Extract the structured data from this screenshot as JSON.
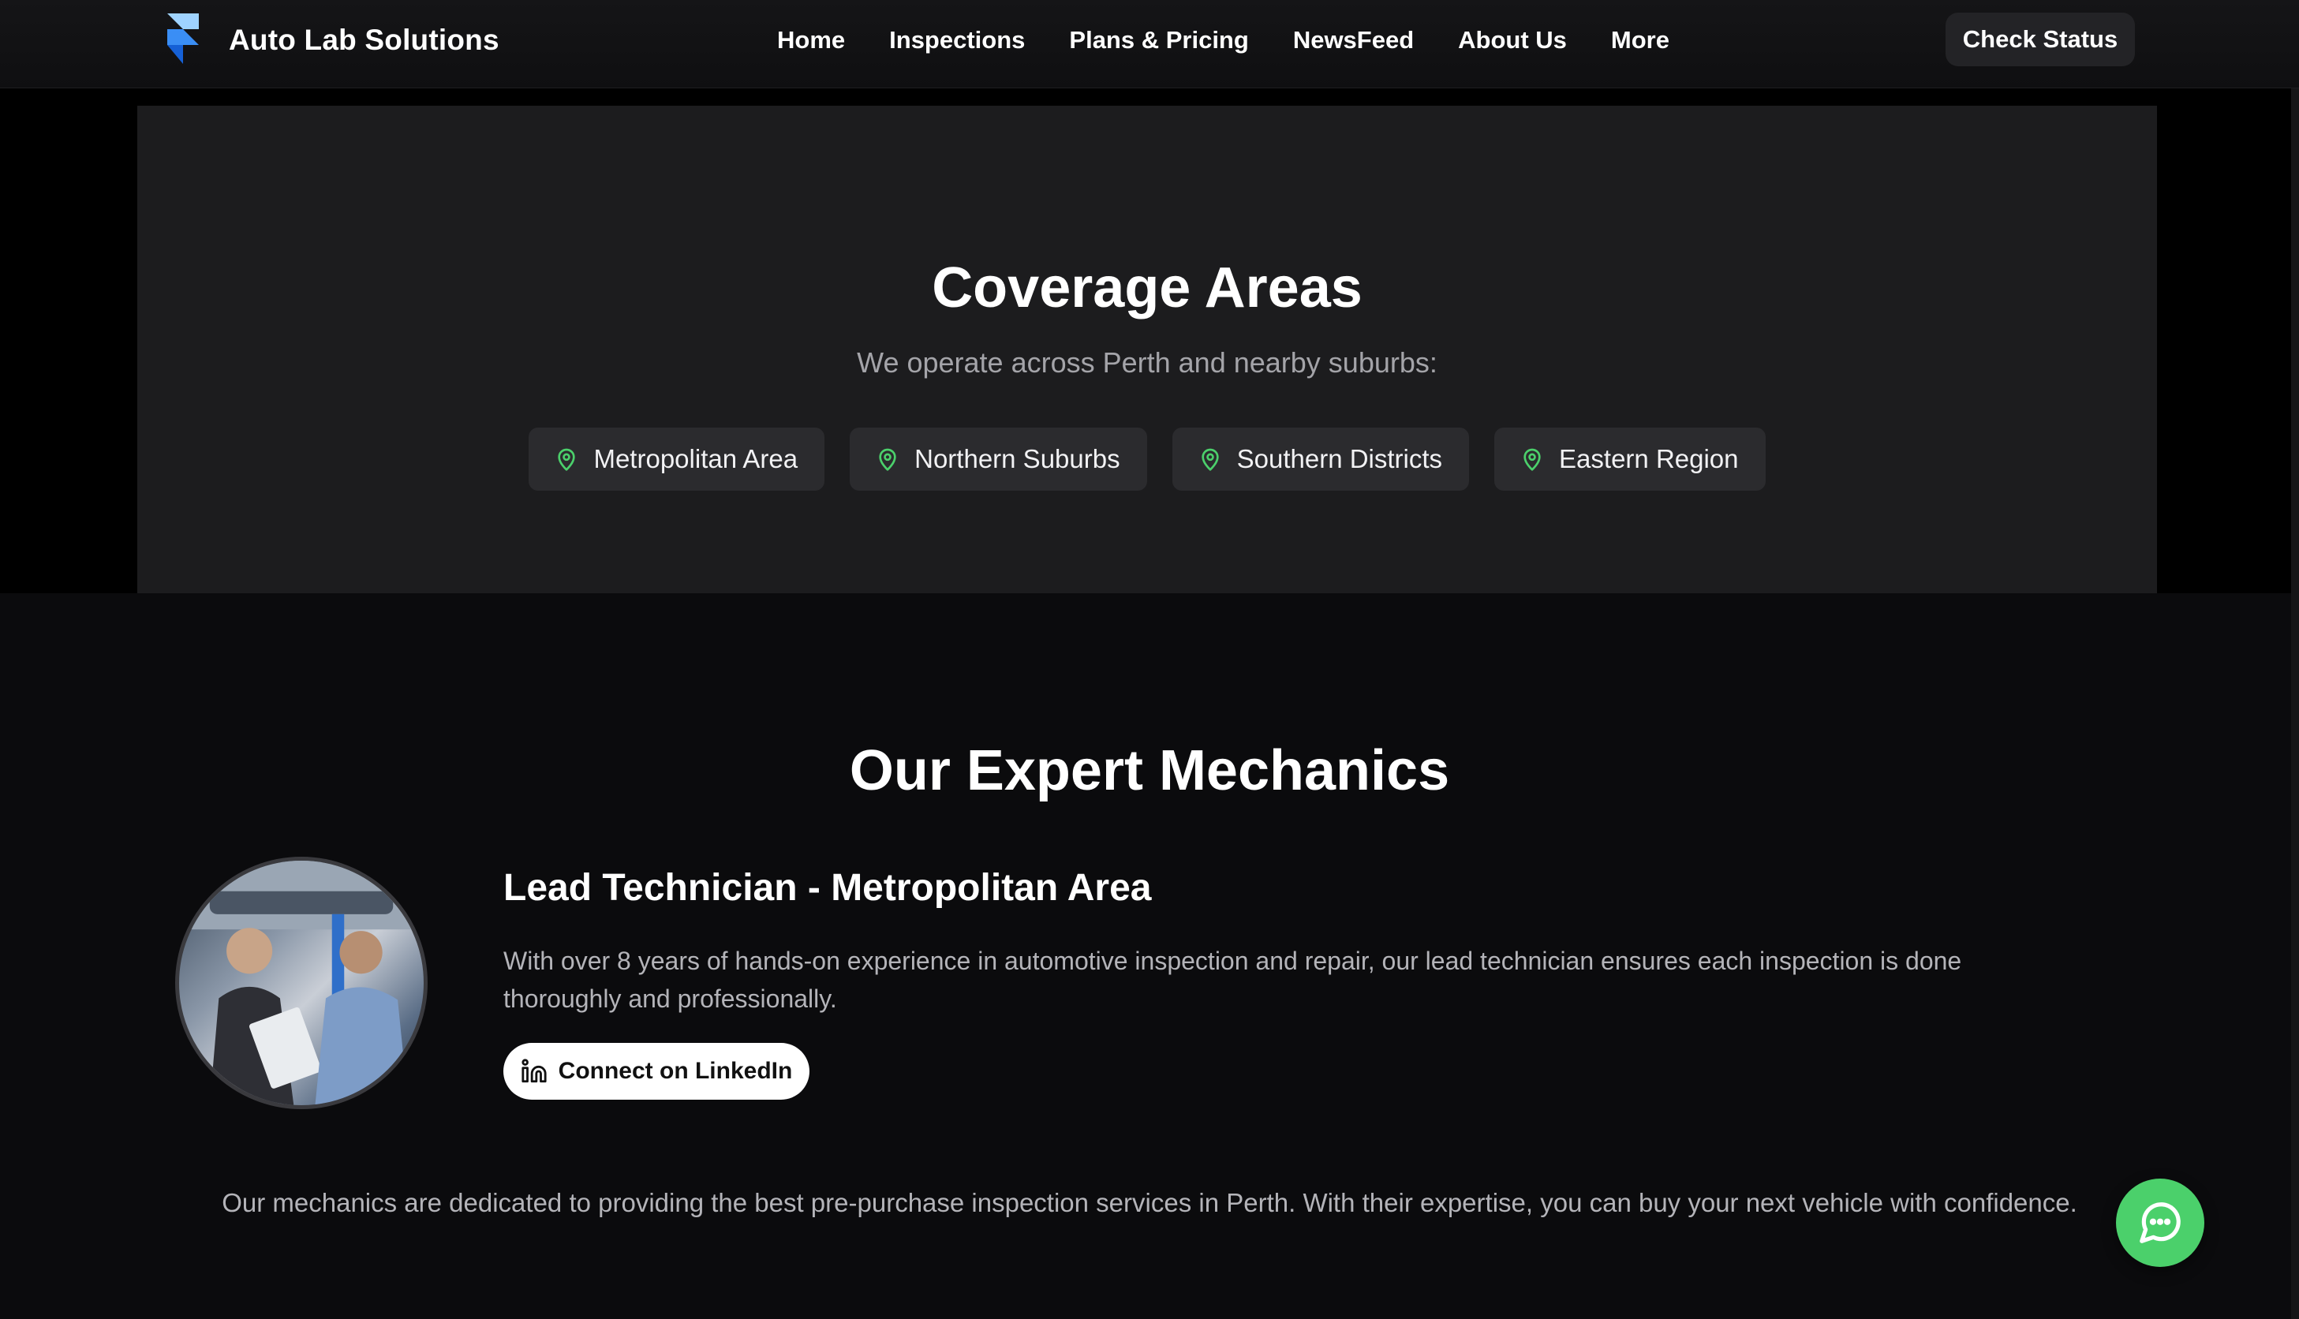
{
  "navbar": {
    "brand_name": "Auto Lab Solutions",
    "links": [
      "Home",
      "Inspections",
      "Plans & Pricing",
      "NewsFeed",
      "About Us",
      "More"
    ],
    "cta_label": "Check Status"
  },
  "coverage": {
    "title": "Coverage Areas",
    "subtitle": "We operate across Perth and nearby suburbs:",
    "areas": [
      "Metropolitan Area",
      "Northern Suburbs",
      "Southern Districts",
      "Eastern Region"
    ]
  },
  "mechanics": {
    "title": "Our Expert Mechanics",
    "technician": {
      "role": "Lead Technician - Metropolitan Area",
      "description": "With over 8 years of hands-on experience in automotive inspection and repair, our lead technician ensures each inspection is done thoroughly and professionally.",
      "linkedin_label": "Connect on LinkedIn"
    },
    "footer_note": "Our mechanics are dedicated to providing the best pre-purchase inspection services in Perth. With their expertise, you can buy your next vehicle with confidence."
  },
  "icons": {
    "brand": "framer-logo-icon",
    "area": "map-pin-icon",
    "linkedin": "linkedin-icon",
    "chat": "chat-bubble-icon"
  },
  "colors": {
    "accent_green": "#4bd06b",
    "pin_green": "#4bd06b",
    "brand_blue": "#1e7cf0",
    "brand_light_blue": "#7cc2ff"
  }
}
